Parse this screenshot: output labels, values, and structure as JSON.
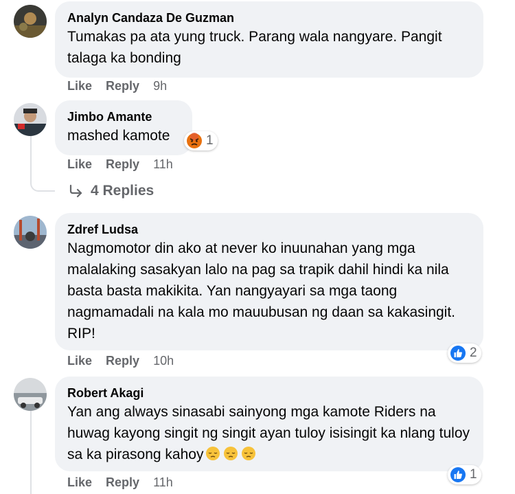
{
  "comments": [
    {
      "author": "Analyn Candaza De Guzman",
      "text": "Tumakas pa ata yung truck. Parang wala nangyare. Pangit talaga ka bonding",
      "like": "Like",
      "reply": "Reply",
      "time": "9h"
    },
    {
      "author": "Jimbo Amante",
      "text": "mashed kamote",
      "like": "Like",
      "reply": "Reply",
      "time": "11h",
      "reaction": {
        "icon": "angry-reaction-icon",
        "count": "1"
      },
      "view_replies": "4 Replies"
    },
    {
      "author": "Zdref Ludsa",
      "text": "Nagmomotor din ako at never ko inuunahan yang mga malalaking sasakyan lalo na pag sa trapik dahil hindi ka nila basta basta makikita. Yan nangyayari sa mga taong nagmamadali na kala mo mauubusan ng daan sa kakasingit. RIP!",
      "like": "Like",
      "reply": "Reply",
      "time": "10h",
      "reaction": {
        "icon": "like-reaction-icon",
        "count": "2"
      }
    },
    {
      "author": "Robert Akagi",
      "text": "Yan ang always sinasabi sainyong mga kamote Riders na huwag kayong singit ng singit ayan tuloy isisingit ka nlang tuloy sa ka pirasong kahoy",
      "emoji": [
        "pensive-face-icon",
        "pensive-face-icon",
        "pensive-face-icon"
      ],
      "like": "Like",
      "reply": "Reply",
      "time": "11h",
      "reaction": {
        "icon": "like-reaction-icon",
        "count": "1"
      }
    }
  ],
  "colors": {
    "bubble": "#f0f2f5",
    "secondary_text": "#65676b",
    "like_blue": "#1877f2",
    "angry_orange": "#e9710f"
  }
}
